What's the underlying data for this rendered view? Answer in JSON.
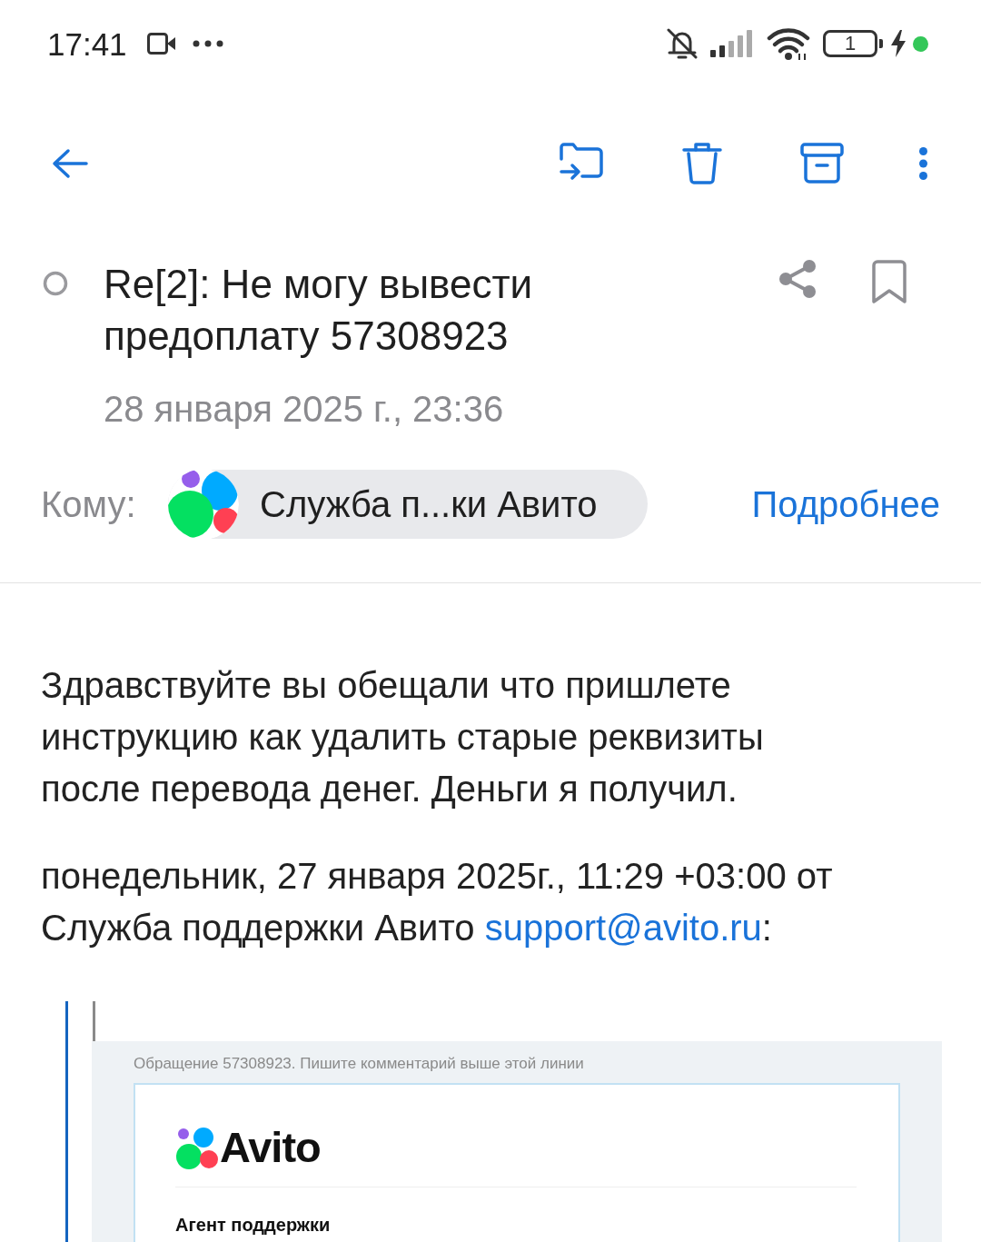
{
  "status_bar": {
    "time": "17:41",
    "battery": "1"
  },
  "message": {
    "subject": "Re[2]: Не могу вывести предоплату 57308923",
    "unread": false,
    "bookmarked": false,
    "date": "28 января 2025 г., 23:36"
  },
  "recipients": {
    "label": "Кому:",
    "chips": [
      {
        "name": "Служба п...ки Авито"
      }
    ],
    "details_link": "Подробнее"
  },
  "body": {
    "paragraph": "Здравствуйте вы обещали что пришлете инструкцию как удалить старые реквизиты после перевода денег. Деньги я получил.",
    "quote_intro": {
      "text": "понедельник, 27 января 2025г., 11:29 +03:00 от Служба поддержки Авито",
      "email": "support@avito.ru",
      "suffix": ":"
    }
  },
  "quoted": {
    "notice": "Обращение 57308923. Пишите комментарий выше этой линии",
    "brand": "Avito",
    "heading": "Агент поддержки"
  }
}
